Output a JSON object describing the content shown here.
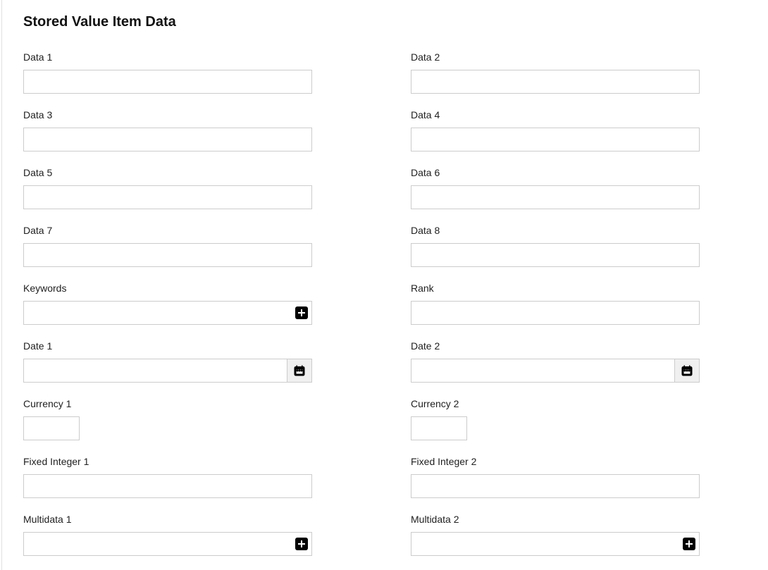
{
  "title": "Stored Value Item Data",
  "fields": {
    "data1": {
      "label": "Data 1",
      "value": ""
    },
    "data2": {
      "label": "Data 2",
      "value": ""
    },
    "data3": {
      "label": "Data 3",
      "value": ""
    },
    "data4": {
      "label": "Data 4",
      "value": ""
    },
    "data5": {
      "label": "Data 5",
      "value": ""
    },
    "data6": {
      "label": "Data 6",
      "value": ""
    },
    "data7": {
      "label": "Data 7",
      "value": ""
    },
    "data8": {
      "label": "Data 8",
      "value": ""
    },
    "keywords": {
      "label": "Keywords",
      "value": ""
    },
    "rank": {
      "label": "Rank",
      "value": ""
    },
    "date1": {
      "label": "Date 1",
      "value": ""
    },
    "date2": {
      "label": "Date 2",
      "value": ""
    },
    "currency1": {
      "label": "Currency 1",
      "value": ""
    },
    "currency2": {
      "label": "Currency 2",
      "value": ""
    },
    "fixedinteger1": {
      "label": "Fixed Integer 1",
      "value": ""
    },
    "fixedinteger2": {
      "label": "Fixed Integer 2",
      "value": ""
    },
    "multidata1": {
      "label": "Multidata 1",
      "value": ""
    },
    "multidata2": {
      "label": "Multidata 2",
      "value": ""
    }
  }
}
